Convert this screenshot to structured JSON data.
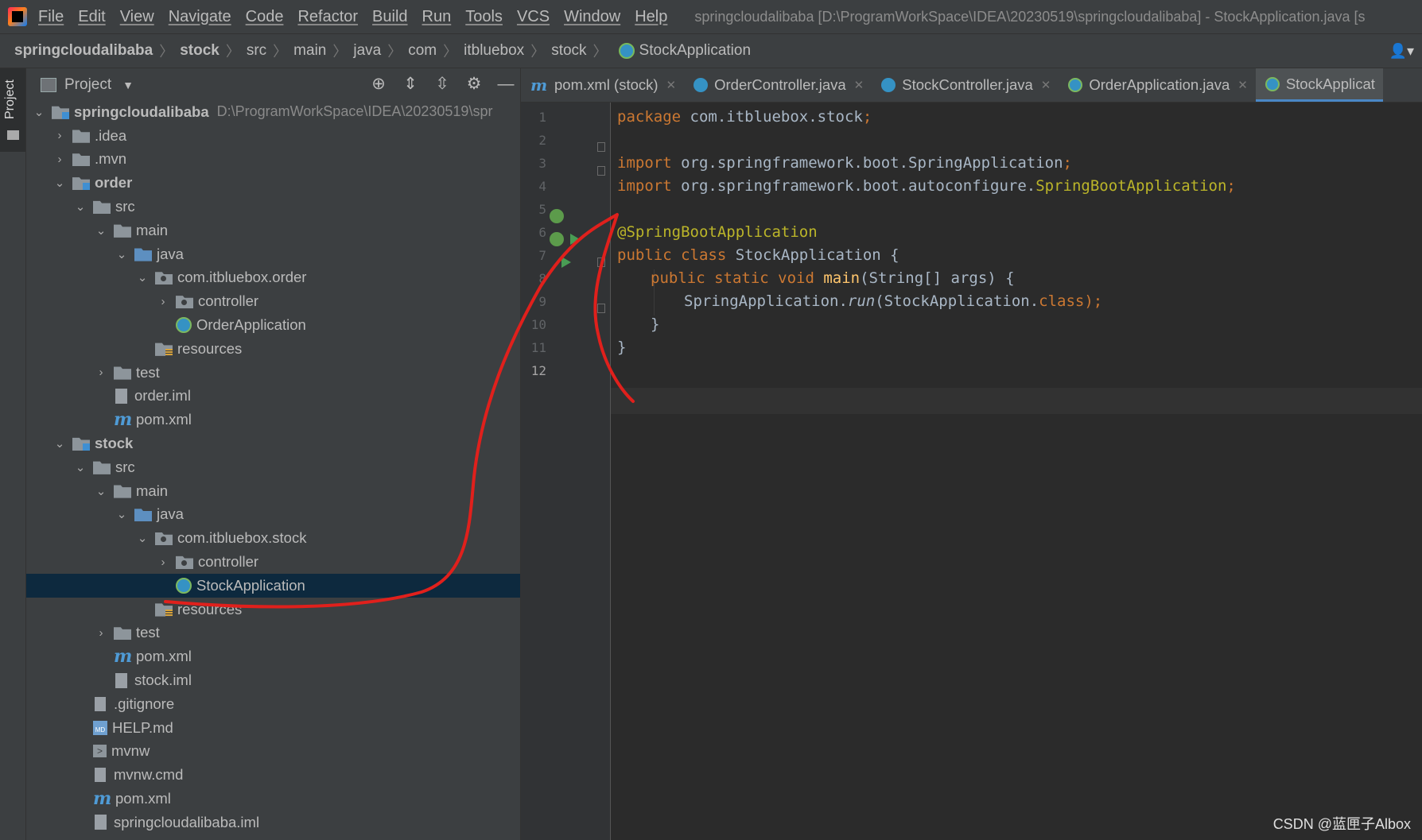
{
  "menubar": {
    "items": [
      "File",
      "Edit",
      "View",
      "Navigate",
      "Code",
      "Refactor",
      "Build",
      "Run",
      "Tools",
      "VCS",
      "Window",
      "Help"
    ],
    "window_title": "springcloudalibaba [D:\\ProgramWorkSpace\\IDEA\\20230519\\springcloudalibaba] - StockApplication.java [s"
  },
  "breadcrumb": [
    "springcloudalibaba",
    "stock",
    "src",
    "main",
    "java",
    "com",
    "itbluebox",
    "stock",
    "StockApplication"
  ],
  "project_panel": {
    "title": "Project",
    "root_path": "D:\\ProgramWorkSpace\\IDEA\\20230519\\spr",
    "stripe_label": "Project"
  },
  "tree": [
    {
      "label": "springcloudalibaba",
      "depth": 0,
      "expanded": true,
      "icon": "folder-module",
      "bold": true
    },
    {
      "label": ".idea",
      "depth": 1,
      "expanded": false,
      "icon": "folder"
    },
    {
      "label": ".mvn",
      "depth": 1,
      "expanded": false,
      "icon": "folder"
    },
    {
      "label": "order",
      "depth": 1,
      "expanded": true,
      "icon": "folder-module",
      "bold": true
    },
    {
      "label": "src",
      "depth": 2,
      "expanded": true,
      "icon": "folder"
    },
    {
      "label": "main",
      "depth": 3,
      "expanded": true,
      "icon": "folder"
    },
    {
      "label": "java",
      "depth": 4,
      "expanded": true,
      "icon": "folder-blue"
    },
    {
      "label": "com.itbluebox.order",
      "depth": 5,
      "expanded": true,
      "icon": "package"
    },
    {
      "label": "controller",
      "depth": 6,
      "expanded": false,
      "icon": "package"
    },
    {
      "label": "OrderApplication",
      "depth": 6,
      "icon": "springclass"
    },
    {
      "label": "resources",
      "depth": 5,
      "icon": "resources"
    },
    {
      "label": "test",
      "depth": 3,
      "expanded": false,
      "icon": "folder"
    },
    {
      "label": "order.iml",
      "depth": 3,
      "icon": "file"
    },
    {
      "label": "pom.xml",
      "depth": 3,
      "icon": "maven"
    },
    {
      "label": "stock",
      "depth": 1,
      "expanded": true,
      "icon": "folder-module",
      "bold": true
    },
    {
      "label": "src",
      "depth": 2,
      "expanded": true,
      "icon": "folder"
    },
    {
      "label": "main",
      "depth": 3,
      "expanded": true,
      "icon": "folder"
    },
    {
      "label": "java",
      "depth": 4,
      "expanded": true,
      "icon": "folder-blue"
    },
    {
      "label": "com.itbluebox.stock",
      "depth": 5,
      "expanded": true,
      "icon": "package"
    },
    {
      "label": "controller",
      "depth": 6,
      "expanded": false,
      "icon": "package"
    },
    {
      "label": "StockApplication",
      "depth": 6,
      "icon": "springclass",
      "selected": true
    },
    {
      "label": "resources",
      "depth": 5,
      "icon": "resources"
    },
    {
      "label": "test",
      "depth": 3,
      "expanded": false,
      "icon": "folder"
    },
    {
      "label": "pom.xml",
      "depth": 3,
      "icon": "maven"
    },
    {
      "label": "stock.iml",
      "depth": 3,
      "icon": "file"
    },
    {
      "label": ".gitignore",
      "depth": 2,
      "icon": "textfile"
    },
    {
      "label": "HELP.md",
      "depth": 2,
      "icon": "md"
    },
    {
      "label": "mvnw",
      "depth": 2,
      "icon": "shell"
    },
    {
      "label": "mvnw.cmd",
      "depth": 2,
      "icon": "textfile"
    },
    {
      "label": "pom.xml",
      "depth": 2,
      "icon": "maven"
    },
    {
      "label": "springcloudalibaba.iml",
      "depth": 2,
      "icon": "file"
    }
  ],
  "tabs": [
    {
      "label": "pom.xml (stock)",
      "icon": "maven"
    },
    {
      "label": "OrderController.java",
      "icon": "class"
    },
    {
      "label": "StockController.java",
      "icon": "class"
    },
    {
      "label": "OrderApplication.java",
      "icon": "spring"
    },
    {
      "label": "StockApplicat",
      "icon": "spring",
      "active": true
    }
  ],
  "code": {
    "current_line": 12,
    "lines": [
      "1",
      "2",
      "3",
      "4",
      "5",
      "6",
      "7",
      "8",
      "9",
      "10",
      "11",
      "12"
    ],
    "l1": [
      "package",
      " com.itbluebox.stock",
      ";"
    ],
    "l3": [
      "import",
      " org.springframework.boot.SpringApplication",
      ";"
    ],
    "l4": [
      "import",
      " org.springframework.boot.autoconfigure.",
      "SpringBootApplication",
      ";"
    ],
    "l6": "@SpringBootApplication",
    "l7": [
      "public class",
      " StockApplication {"
    ],
    "l8": [
      "public static void ",
      "main",
      "(String[] args) {"
    ],
    "l9": [
      "SpringApplication.",
      "run",
      "(StockApplication.",
      "class",
      ");"
    ],
    "l10": "}",
    "l11": "}"
  },
  "watermark": "CSDN @蓝匣子Albox",
  "colors": {
    "annotation_stroke": "#e0201c",
    "selection": "#0d293e",
    "keyword": "#cc7832",
    "annotation": "#bbb529"
  }
}
